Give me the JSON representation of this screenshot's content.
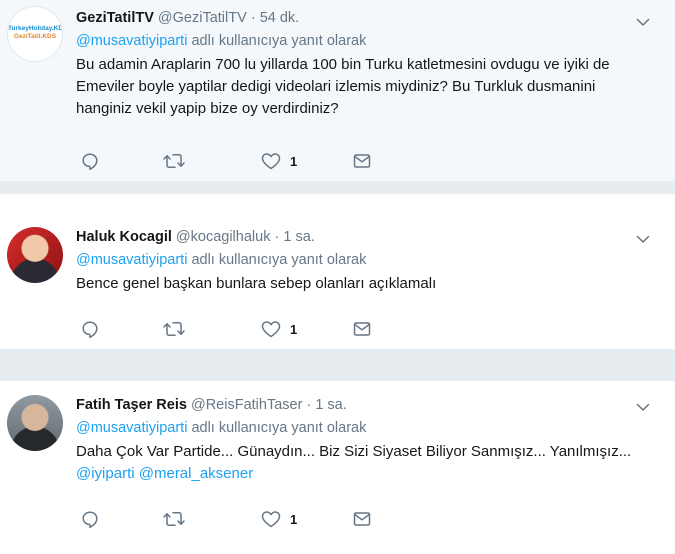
{
  "tweets": [
    {
      "name": "GeziTatilTV",
      "handle": "@GeziTatilTV",
      "sep": "·",
      "time": "54 dk.",
      "avatar_lines": [
        "TurkeyHoliday.KDS",
        "GeziTatil.KDS"
      ],
      "reply_to": "@musavatiyiparti",
      "reply_suffix": " adlı kullanıcıya yanıt olarak",
      "text": "Bu adamin Araplarin 700 lu yillarda 100 bin Turku katletmesini ovdugu ve iyiki de Emeviler boyle yaptilar dedigi videolari izlemis miydiniz? Bu Turkluk dusmanini hanginiz vekil yapip bize oy verdirdiniz?",
      "like_count": "1"
    },
    {
      "name": "Haluk Kocagil",
      "handle": "@kocagilhaluk",
      "sep": "·",
      "time": "1 sa.",
      "reply_to": "@musavatiyiparti",
      "reply_suffix": " adlı kullanıcıya yanıt olarak",
      "text": "Bence genel başkan bunlara sebep olanları açıklamalı",
      "like_count": "1"
    },
    {
      "name": "Fatih Taşer Reis",
      "handle": "@ReisFatihTaser",
      "sep": "·",
      "time": "1 sa.",
      "reply_to": "@musavatiyiparti",
      "reply_suffix": " adlı kullanıcıya yanıt olarak",
      "text": "Daha Çok Var Partide... Günaydın... Biz Sizi Siyaset Biliyor Sanmışız... Yanılmışız... ",
      "text_mentions": [
        "@iyiparti",
        "@meral_aksener"
      ],
      "like_count": "1"
    }
  ],
  "colors": {
    "accent": "#1da1f2",
    "secondary": "#657786",
    "text": "#14171a",
    "highlight_bg": "#f5f8fa"
  },
  "icons": [
    "reply-icon",
    "retweet-icon",
    "like-icon",
    "message-icon",
    "chevron-down-icon"
  ]
}
